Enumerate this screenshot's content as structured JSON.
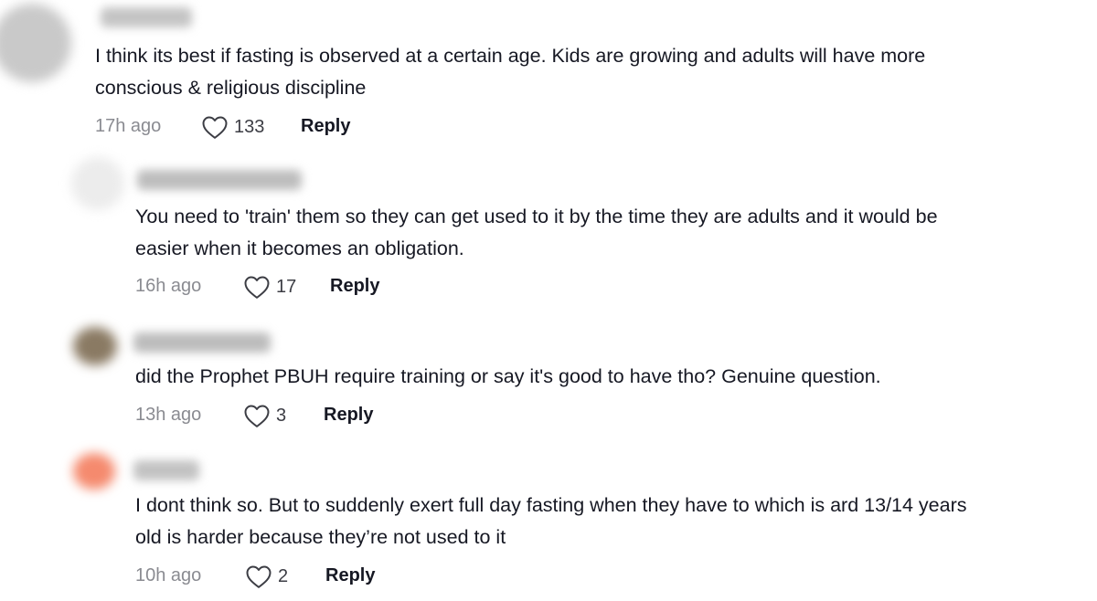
{
  "comments": [
    {
      "text_lines": [
        "I think its best if fasting is observed at a certain age. Kids are growing and adults will have more",
        "conscious & religious discipline"
      ],
      "time": "17h ago",
      "likes": "133",
      "reply_label": "Reply",
      "avatar_color": "#c9c9c9"
    },
    {
      "text_lines": [
        "You need to 'train' them so they can get used to it by the time they are adults and it would be",
        "easier when it becomes an obligation."
      ],
      "time": "16h ago",
      "likes": "17",
      "reply_label": "Reply",
      "avatar_color": "#ececec"
    },
    {
      "text_lines": [
        "did the Prophet PBUH require training or say it's good to have tho? Genuine question."
      ],
      "time": "13h ago",
      "likes": "3",
      "reply_label": "Reply",
      "avatar_color": "#8a7a63"
    },
    {
      "text_lines": [
        "I dont think so. But to suddenly exert full day fasting when they have to which is ard 13/14 years",
        "old is harder because they’re not used to it"
      ],
      "time": "10h ago",
      "likes": "2",
      "reply_label": "Reply",
      "avatar_color": "#f58a6e"
    }
  ],
  "icons": {
    "like": "heart-outline-icon"
  },
  "colors": {
    "text": "#161823",
    "meta": "#8a8b91",
    "like_count": "#3c3d44"
  }
}
